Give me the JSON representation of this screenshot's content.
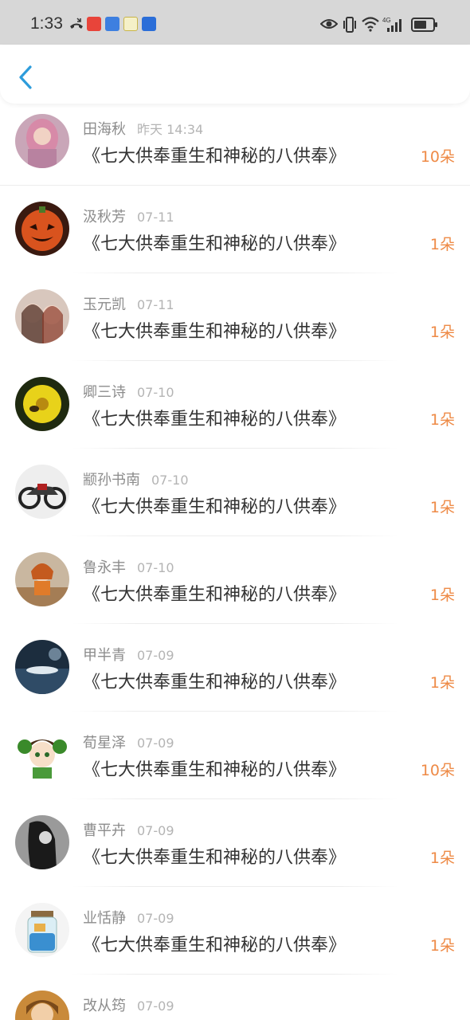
{
  "status_bar": {
    "time": "1:33",
    "left_icons": [
      "missed-call-icon",
      "app-red-icon",
      "music-app-icon",
      "duck-app-icon",
      "shield-app-icon"
    ],
    "right_icons": [
      "eye-icon",
      "vibrate-icon",
      "wifi-icon",
      "cellular-4g-icon",
      "battery-icon"
    ]
  },
  "nav": {
    "back_icon": "chevron-left-icon"
  },
  "colors": {
    "accent": "#2d9cdb",
    "gift": "#ee8a46",
    "name": "#8c8c8c",
    "date": "#b4b4b4"
  },
  "items": [
    {
      "name": "田海秋",
      "date": "昨天 14:34",
      "content": "《七大供奉重生和神秘的八供奉》",
      "gift": "10朵"
    },
    {
      "name": "汲秋芳",
      "date": "07-11",
      "content": "《七大供奉重生和神秘的八供奉》",
      "gift": "1朵"
    },
    {
      "name": "玉元凯",
      "date": "07-11",
      "content": "《七大供奉重生和神秘的八供奉》",
      "gift": "1朵"
    },
    {
      "name": "卿三诗",
      "date": "07-10",
      "content": "《七大供奉重生和神秘的八供奉》",
      "gift": "1朵"
    },
    {
      "name": "颛孙书南",
      "date": "07-10",
      "content": "《七大供奉重生和神秘的八供奉》",
      "gift": "1朵"
    },
    {
      "name": "鲁永丰",
      "date": "07-10",
      "content": "《七大供奉重生和神秘的八供奉》",
      "gift": "1朵"
    },
    {
      "name": "甲半青",
      "date": "07-09",
      "content": "《七大供奉重生和神秘的八供奉》",
      "gift": "1朵"
    },
    {
      "name": "荀星泽",
      "date": "07-09",
      "content": "《七大供奉重生和神秘的八供奉》",
      "gift": "10朵"
    },
    {
      "name": "曹平卉",
      "date": "07-09",
      "content": "《七大供奉重生和神秘的八供奉》",
      "gift": "1朵"
    },
    {
      "name": "业恬静",
      "date": "07-09",
      "content": "《七大供奉重生和神秘的八供奉》",
      "gift": "1朵"
    },
    {
      "name": "改从筠",
      "date": "07-09",
      "content": "",
      "gift": ""
    }
  ]
}
